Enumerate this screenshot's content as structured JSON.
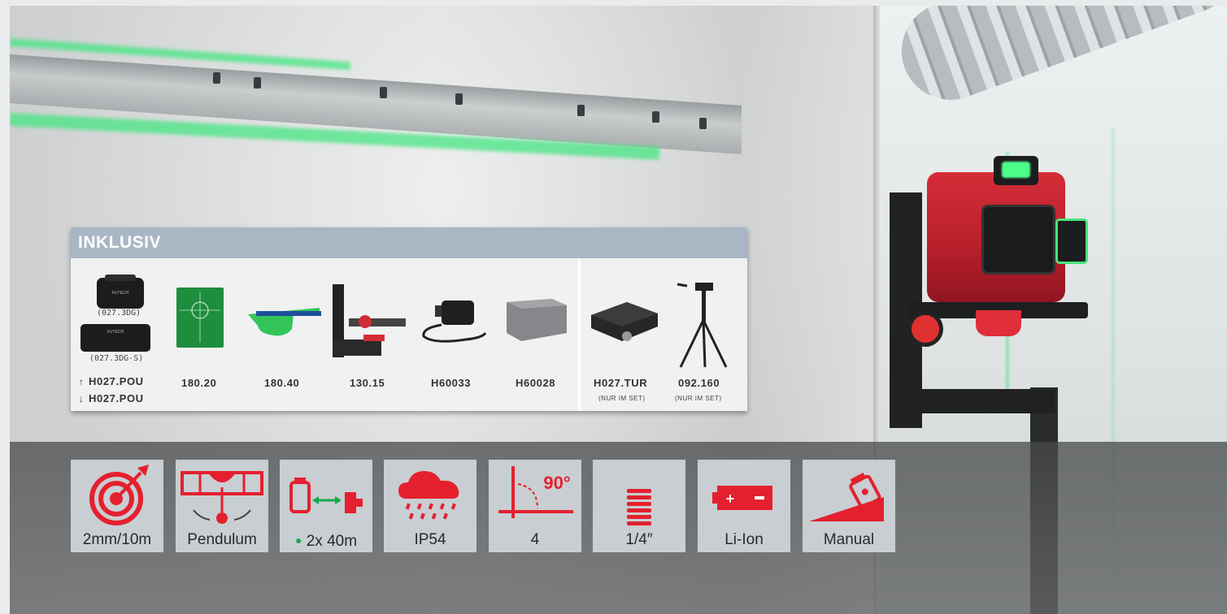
{
  "included": {
    "title": "INKLUSIV",
    "items": [
      {
        "name": "case",
        "code": "H027.POU",
        "code2": "H027.POU",
        "sub1": "(027.3DG)",
        "sub2": "(027.3DG-S)"
      },
      {
        "name": "target-plate",
        "code": "180.20"
      },
      {
        "name": "laser-glasses",
        "code": "180.40"
      },
      {
        "name": "wall-mount",
        "code": "130.15"
      },
      {
        "name": "charger",
        "code": "H60033"
      },
      {
        "name": "battery",
        "code": "H60028"
      },
      {
        "name": "turntable",
        "code": "H027.TUR",
        "note": "(NUR IM SET)"
      },
      {
        "name": "tripod",
        "code": "092.160",
        "note": "(NUR IM SET)"
      }
    ]
  },
  "features": [
    {
      "icon": "target-accuracy-icon",
      "label": "2mm/10m"
    },
    {
      "icon": "pendulum-icon",
      "label": "Pendulum"
    },
    {
      "icon": "receiver-range-icon",
      "label": "2x 40m"
    },
    {
      "icon": "rain-icon",
      "label": "IP54"
    },
    {
      "icon": "angle-90-icon",
      "label": "4",
      "angle": "90°"
    },
    {
      "icon": "thread-icon",
      "label": "1/4″"
    },
    {
      "icon": "battery-icon",
      "label": "Li-Ion"
    },
    {
      "icon": "manual-tilt-icon",
      "label": "Manual"
    }
  ],
  "colors": {
    "accent": "#e4202e",
    "header": "#a9b7c4",
    "tile": "#c9ced2",
    "laser": "#2fd36b"
  }
}
